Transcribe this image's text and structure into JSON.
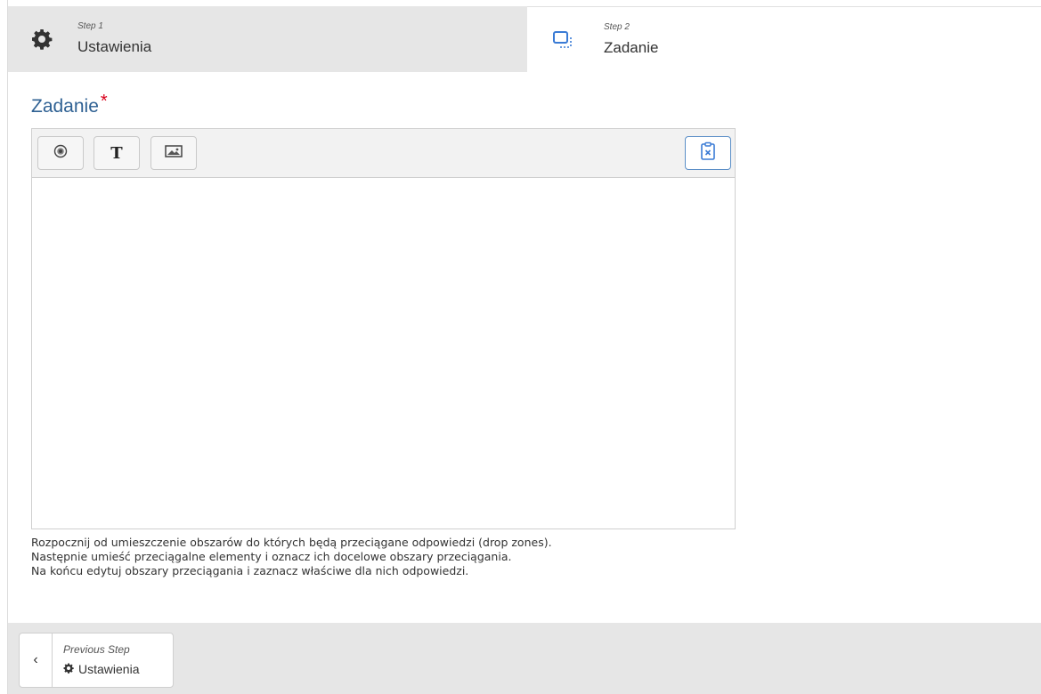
{
  "steps": [
    {
      "number": "Step 1",
      "title": "Ustawienia",
      "icon": "gear-icon",
      "active": false
    },
    {
      "number": "Step 2",
      "title": "Zadanie",
      "icon": "dragdrop-icon",
      "active": true
    }
  ],
  "field": {
    "label": "Zadanie",
    "required_mark": "*"
  },
  "toolbar": {
    "buttons": [
      {
        "name": "drop-zone-button",
        "icon": "target-icon"
      },
      {
        "name": "text-button",
        "icon": "text-icon",
        "label": "T"
      },
      {
        "name": "image-button",
        "icon": "image-icon"
      }
    ],
    "paste_button": {
      "name": "paste-button",
      "icon": "clipboard-x-icon"
    }
  },
  "help": {
    "lines": [
      "Rozpocznij od umieszczenie obszarów do których będą przeciągane odpowiedzi (drop zones).",
      "Następnie umieść przeciągalne elementy i oznacz ich docelowe obszary przeciągania.",
      "Na końcu edytuj obszary przeciągania i zaznacz właściwe dla nich odpowiedzi."
    ]
  },
  "footer": {
    "prev_label": "Previous Step",
    "prev_step": "Ustawienia",
    "prev_arrow": "‹"
  },
  "colors": {
    "accent": "#2f6193",
    "required": "#d9001b",
    "tab_inactive": "#e6e6e6",
    "icon_blue": "#3a7bd5"
  }
}
